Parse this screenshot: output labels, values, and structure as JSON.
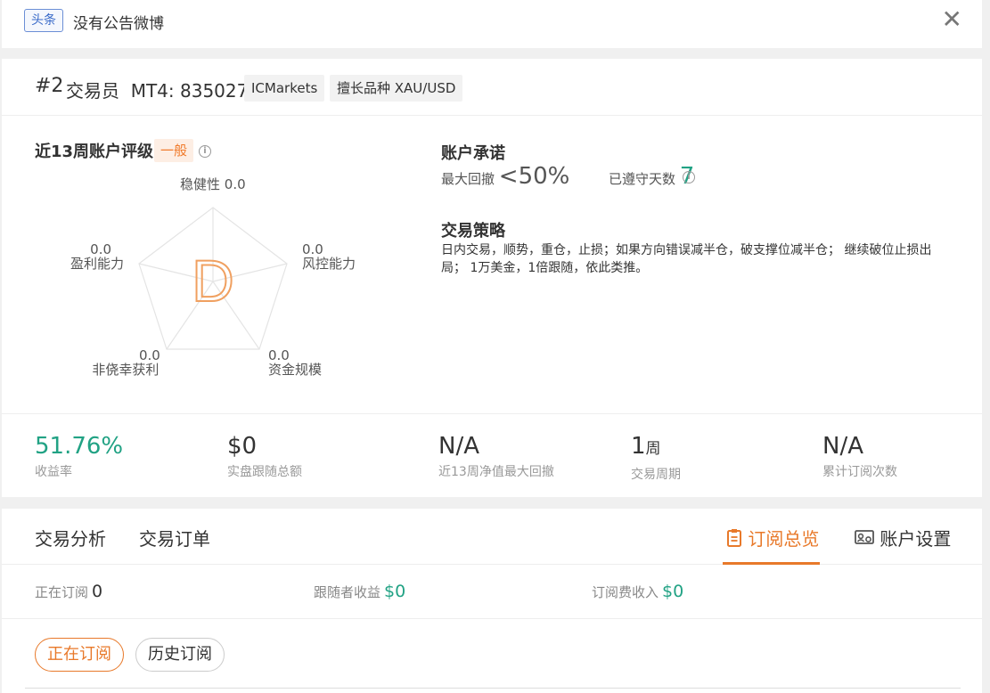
{
  "notice": {
    "tag": "头条",
    "text": "没有公告微博",
    "close_icon": "close-icon"
  },
  "trader": {
    "rank": "#2",
    "mt4": "交易员  MT4: 835027",
    "broker": "ICMarkets",
    "symbol": "擅长品种 XAU/USD"
  },
  "rating": {
    "title": "近13周账户评级",
    "badge": "一般",
    "grade": "D",
    "axes": {
      "stability": {
        "value": "0.0",
        "name": "稳健性"
      },
      "profit": {
        "value": "0.0",
        "name": "盈利能力"
      },
      "risk": {
        "value": "0.0",
        "name": "风控能力"
      },
      "luck": {
        "value": "0.0",
        "name": "非侥幸获利"
      },
      "scale": {
        "value": "0.0",
        "name": "资金规模"
      }
    }
  },
  "promise": {
    "title": "账户承诺",
    "drawdown_label": "最大回撤",
    "drawdown_value": "<50%",
    "days_label": "已遵守天数",
    "days_value": "7"
  },
  "strategy": {
    "title": "交易策略",
    "text": "日内交易，顺势，重仓，止损；如果方向错误减半仓，破支撑位减半仓； 继续破位止损出局； 1万美金，1倍跟随，依此类推。"
  },
  "stats": [
    {
      "value": "51.76%",
      "label": "收益率"
    },
    {
      "value": "$0",
      "label": "实盘跟随总额"
    },
    {
      "value": "N/A",
      "label": "近13周净值最大回撤"
    },
    {
      "value": "1",
      "unit": "周",
      "label": "交易周期"
    },
    {
      "value": "N/A",
      "label": "累计订阅次数"
    }
  ],
  "tabs": {
    "analysis": "交易分析",
    "orders": "交易订单",
    "overview": "订阅总览",
    "settings": "账户设置"
  },
  "subscription": {
    "active_label": "正在订阅",
    "active_value": "0",
    "follower_label": "跟随者收益",
    "follower_value": "$0",
    "fee_label": "订阅费收入",
    "fee_value": "$0"
  },
  "filters": {
    "current": "正在订阅",
    "history": "历史订阅"
  },
  "colors": {
    "accent_orange": "#e8792a",
    "accent_green": "#21a284",
    "tag_blue": "#3a6bc9"
  }
}
